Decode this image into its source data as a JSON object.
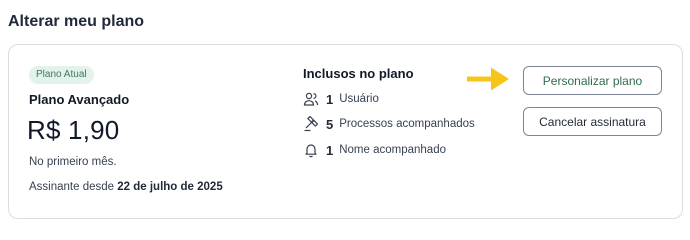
{
  "section": {
    "title": "Alterar meu plano"
  },
  "plan": {
    "badge": "Plano Atual",
    "name": "Plano Avançado",
    "price": "R$ 1,90",
    "note": "No primeiro mês.",
    "since_prefix": "Assinante desde",
    "since_date": "22 de julho de 2025"
  },
  "included": {
    "title": "Inclusos no plano",
    "items": [
      {
        "icon": "users-icon",
        "count": "1",
        "label": "Usuário"
      },
      {
        "icon": "gavel-icon",
        "count": "5",
        "label": "Processos acompanhados"
      },
      {
        "icon": "bell-icon",
        "count": "1",
        "label": "Nome acompanhado"
      }
    ]
  },
  "actions": {
    "customize_label": "Personalizar plano",
    "cancel_label": "Cancelar assinatura"
  },
  "colors": {
    "badge_bg": "#e3f2ea",
    "badge_text": "#3d7a5e",
    "accent_green": "#2f6b4f",
    "arrow": "#f5c518",
    "border": "#d9dde3"
  }
}
